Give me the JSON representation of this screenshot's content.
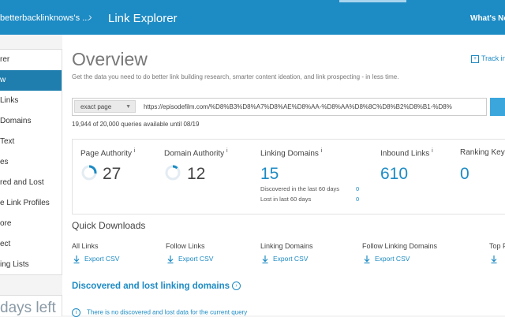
{
  "header": {
    "account": "betterbacklinknows's ...",
    "separator": "›",
    "title": "Link Explorer",
    "whats_new": "What's New"
  },
  "sidebar": {
    "items": [
      {
        "label": "rer",
        "active": false
      },
      {
        "label": "w",
        "active": true
      },
      {
        "label": "Links",
        "active": false
      },
      {
        "label": "Domains",
        "active": false
      },
      {
        "label": "Text",
        "active": false
      },
      {
        "label": "es",
        "active": false
      },
      {
        "label": "red and Lost",
        "active": false
      },
      {
        "label": "e Link Profiles",
        "active": false
      },
      {
        "label": "ore",
        "active": false
      },
      {
        "label": "ect",
        "active": false
      },
      {
        "label": "ing Lists",
        "active": false
      }
    ],
    "days_left": "days left"
  },
  "main": {
    "title": "Overview",
    "track": "Track in",
    "subtitle": "Get the data you need to do better link building research, smarter content ideation, and link prospecting - in less time.",
    "search": {
      "mode": "exact page",
      "url": "https://episodefilm.com/%D8%B3%D8%A7%D8%AE%D8%AA-%D8%AA%D8%8C%D8%B2%D8%B1-%D8%"
    },
    "quota": "19,944 of 20,000 queries available until 08/19"
  },
  "metrics": {
    "page_authority": {
      "label": "Page Authority",
      "value": "27",
      "gauge_fraction": 0.27
    },
    "domain_authority": {
      "label": "Domain Authority",
      "value": "12",
      "gauge_fraction": 0.12
    },
    "linking_domains": {
      "label": "Linking Domains",
      "value": "15",
      "discovered_label": "Discovered in the last 60 days",
      "discovered_value": "0",
      "lost_label": "Lost in last 60 days",
      "lost_value": "0"
    },
    "inbound_links": {
      "label": "Inbound Links",
      "value": "610"
    },
    "ranking_keywords": {
      "label": "Ranking Key",
      "value": "0"
    },
    "info_glyph": "i"
  },
  "quick_downloads": {
    "title": "Quick Downloads",
    "export_label": "Export CSV",
    "items": [
      "All Links",
      "Follow Links",
      "Linking Domains",
      "Follow Linking Domains",
      "Top P"
    ]
  },
  "discovered": {
    "title": "Discovered and lost linking domains",
    "no_data": "There is no discovered and lost data for the current query"
  },
  "colors": {
    "brand": "#1d8bc4",
    "active_nav": "#1f7eae",
    "gauge_track": "#e3ecf2"
  }
}
